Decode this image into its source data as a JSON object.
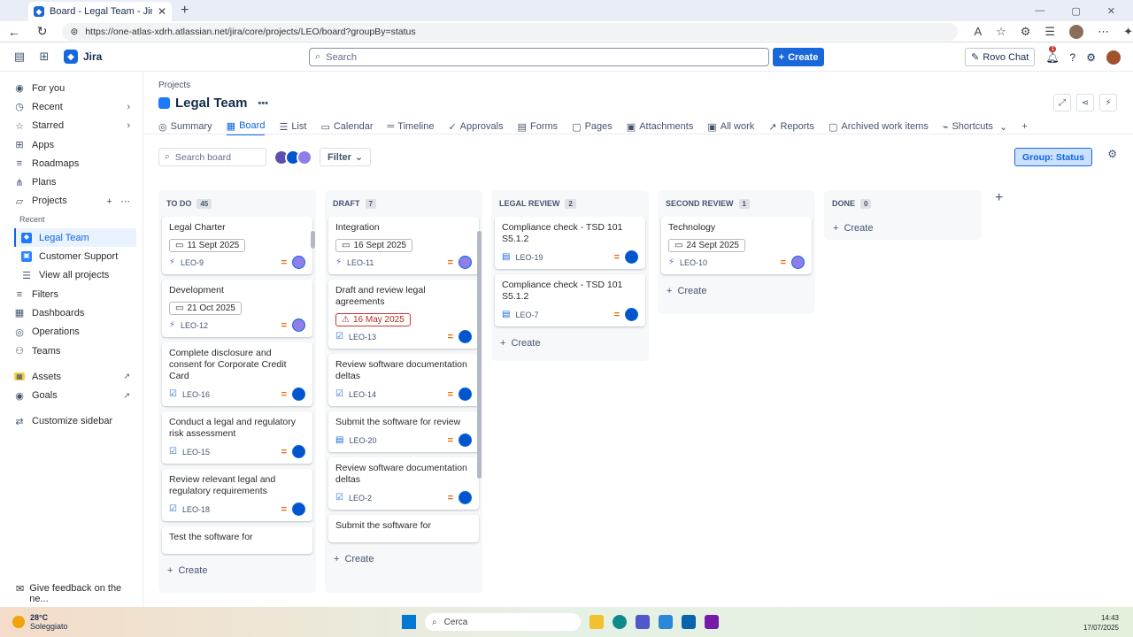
{
  "browser": {
    "tab_title": "Board - Legal Team - Jira",
    "url": "https://one-atlas-xdrh.atlassian.net/jira/core/projects/LEO/board?groupBy=status"
  },
  "topbar": {
    "app_name": "Jira",
    "search_placeholder": "Search",
    "create_label": "Create",
    "rovo_label": "Rovo Chat",
    "notif_badge": "1"
  },
  "sidebar": {
    "items": [
      {
        "label": "For you",
        "icon": "user-circle-icon"
      },
      {
        "label": "Recent",
        "icon": "clock-icon"
      },
      {
        "label": "Starred",
        "icon": "star-icon"
      },
      {
        "label": "Apps",
        "icon": "apps-icon"
      },
      {
        "label": "Roadmaps",
        "icon": "roadmap-icon"
      },
      {
        "label": "Plans",
        "icon": "plans-icon"
      },
      {
        "label": "Projects",
        "icon": "folder-icon"
      }
    ],
    "recent_label": "Recent",
    "recent_projects": [
      "Legal Team",
      "Customer Support"
    ],
    "view_all": "View all projects",
    "lower_items": [
      "Filters",
      "Dashboards",
      "Operations",
      "Teams"
    ],
    "external": [
      "Assets",
      "Goals"
    ],
    "customize": "Customize sidebar",
    "feedback": "Give feedback on the ne..."
  },
  "project": {
    "breadcrumb": "Projects",
    "title": "Legal Team",
    "more": "•••",
    "tabs": [
      "Summary",
      "Board",
      "List",
      "Calendar",
      "Timeline",
      "Approvals",
      "Forms",
      "Pages",
      "Attachments",
      "All work",
      "Reports",
      "Archived work items",
      "Shortcuts"
    ],
    "active_tab": "Board"
  },
  "board": {
    "search_placeholder": "Search board",
    "filter_label": "Filter",
    "group_label": "Group: Status",
    "create_label": "Create",
    "columns": [
      {
        "name": "TO DO",
        "count": "45",
        "cards": [
          {
            "title": "Legal Charter",
            "date": "11 Sept 2025",
            "key": "LEO-9",
            "type": "subtask"
          },
          {
            "title": "Development",
            "date": "21 Oct 2025",
            "key": "LEO-12",
            "type": "subtask"
          },
          {
            "title": "Complete disclosure and consent for Corporate Credit Card",
            "date": "",
            "key": "LEO-16",
            "type": "task"
          },
          {
            "title": "Conduct a legal and regulatory risk assessment",
            "date": "",
            "key": "LEO-15",
            "type": "task"
          },
          {
            "title": "Review relevant legal and regulatory requirements",
            "date": "",
            "key": "LEO-18",
            "type": "task"
          },
          {
            "title": "Test the software for",
            "date": "",
            "key": "",
            "type": "task"
          }
        ]
      },
      {
        "name": "DRAFT",
        "count": "7",
        "cards": [
          {
            "title": "Integration",
            "date": "16 Sept 2025",
            "key": "LEO-11",
            "type": "subtask"
          },
          {
            "title": "Draft and review legal agreements",
            "date": "16 May 2025",
            "key": "LEO-13",
            "type": "task",
            "overdue": true
          },
          {
            "title": "Review software documentation deltas",
            "date": "",
            "key": "LEO-14",
            "type": "task"
          },
          {
            "title": "Submit the software for review",
            "date": "",
            "key": "LEO-20",
            "type": "story"
          },
          {
            "title": "Review software documentation deltas",
            "date": "",
            "key": "LEO-2",
            "type": "task"
          },
          {
            "title": "Submit the software for",
            "date": "",
            "key": "",
            "type": "story"
          }
        ]
      },
      {
        "name": "LEGAL REVIEW",
        "count": "2",
        "cards": [
          {
            "title": "Compliance check - TSD 101 S5.1.2",
            "date": "",
            "key": "LEO-19",
            "type": "story"
          },
          {
            "title": "Compliance check - TSD 101 S5.1.2",
            "date": "",
            "key": "LEO-7",
            "type": "story"
          }
        ]
      },
      {
        "name": "SECOND REVIEW",
        "count": "1",
        "cards": [
          {
            "title": "Technology",
            "date": "24 Sept 2025",
            "key": "LEO-10",
            "type": "subtask"
          }
        ]
      },
      {
        "name": "DONE",
        "count": "0",
        "cards": []
      }
    ]
  },
  "taskbar": {
    "temp": "28°C",
    "weather": "Soleggiato",
    "search": "Cerca",
    "time": "14:43",
    "date": "17/07/2025"
  }
}
